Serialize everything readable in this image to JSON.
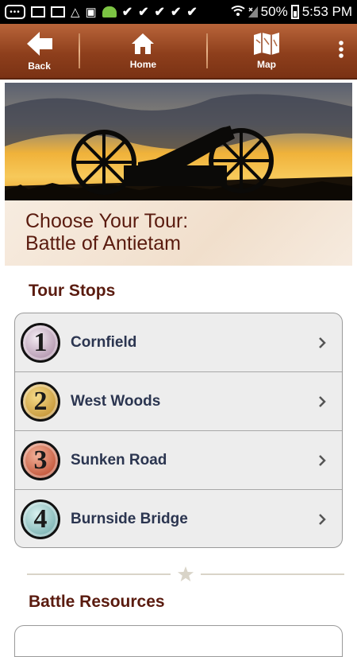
{
  "status_bar": {
    "battery": "50%",
    "time": "5:53 PM"
  },
  "toolbar": {
    "back_label": "Back",
    "home_label": "Home",
    "map_label": "Map"
  },
  "hero": {
    "title_line1": "Choose Your Tour:",
    "title_line2": "Battle of Antietam"
  },
  "tour_stops": {
    "heading": "Tour Stops",
    "items": [
      {
        "number": "1",
        "label": "Cornfield",
        "badge_color": "#d9c8d6"
      },
      {
        "number": "2",
        "label": "West Woods",
        "badge_color": "#c9a14a"
      },
      {
        "number": "3",
        "label": "Sunken Road",
        "badge_color": "#c9614a"
      },
      {
        "number": "4",
        "label": "Burnside Bridge",
        "badge_color": "#8fbfbf"
      }
    ]
  },
  "resources": {
    "heading": "Battle Resources"
  },
  "colors": {
    "toolbar": "#8e3f1c",
    "heading": "#5a1b0f",
    "item_text": "#2b3550"
  }
}
